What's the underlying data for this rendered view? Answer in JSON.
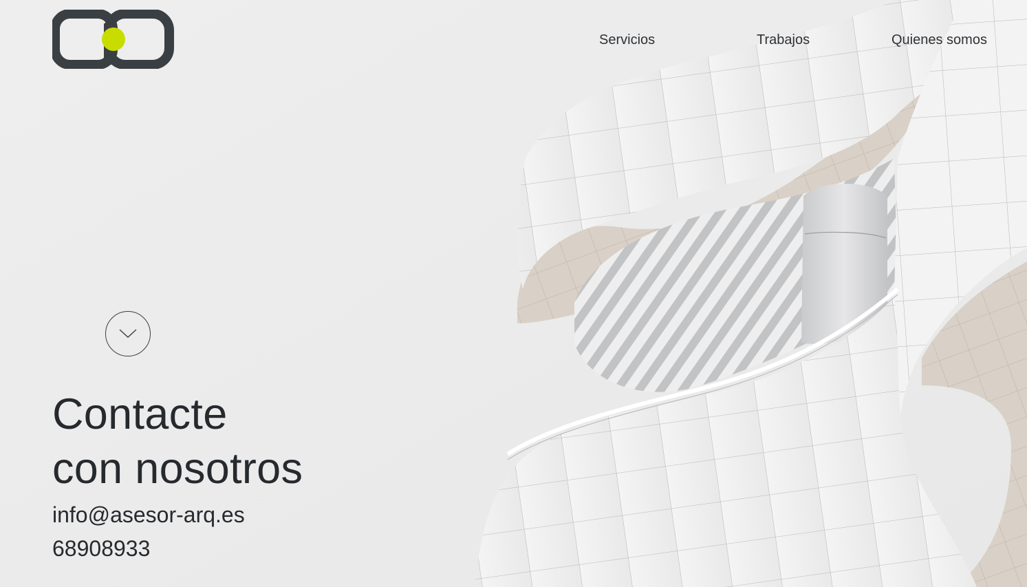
{
  "brand": {
    "logo_text": "ab",
    "colors": {
      "dark": "#3a3f43",
      "accent": "#c8dc00"
    }
  },
  "nav": {
    "items": [
      {
        "label": "Servicios"
      },
      {
        "label": "Trabajos"
      },
      {
        "label": "Quienes somos"
      }
    ]
  },
  "hero": {
    "scroll_icon": "chevron-down-icon",
    "title_line1": "Contacte",
    "title_line2": "con nosotros",
    "email": "info@asesor-arq.es",
    "phone": "68908933"
  },
  "colors": {
    "background": "#ececec",
    "text": "#26292d"
  }
}
